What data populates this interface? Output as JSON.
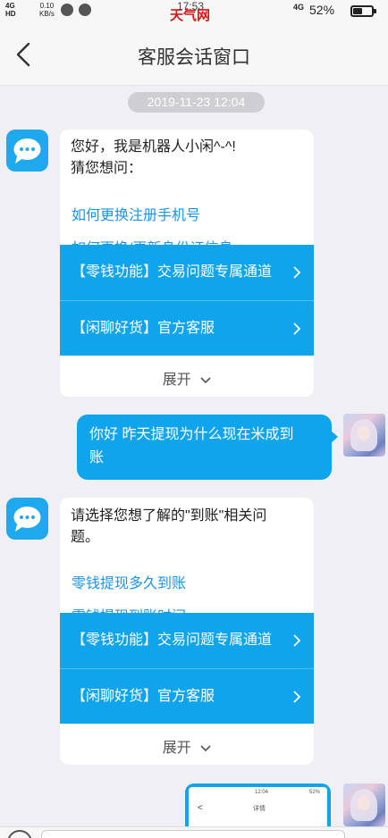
{
  "status_bar": {
    "network_top": "4G",
    "network_bottom": "HD",
    "speed_value": "0.10",
    "speed_unit": "KB/s",
    "clock": "17:53",
    "watermark": "天气网",
    "net_right": "4G",
    "battery_pct": "52%",
    "battery_level": 0.52
  },
  "nav": {
    "title": "客服会话窗口"
  },
  "timestamp": "2019-11-23 12:04",
  "bot_message_1": {
    "line1": "您好，我是机器人小闲^-^!",
    "line2": "猜您想问：",
    "link1": "如何更换注册手机号",
    "link2_cut": "如何更换/更新身份证信息"
  },
  "options": {
    "opt1": "【零钱功能】交易问题专属通道",
    "opt2": "【闲聊好货】官方客服",
    "expand": "展开"
  },
  "user_message": {
    "line1": "你好  昨天提现为什么现在米成到",
    "line2": "账"
  },
  "bot_message_2": {
    "line1": "请选择您想了解的\"到账\"相关问",
    "line2": "题。",
    "link1": "零钱提现多久到账",
    "link2_cut": "零钱提现到账时间"
  },
  "shot": {
    "time": "12:04",
    "title": "详情",
    "battery": "52%",
    "back": "<"
  },
  "colors": {
    "accent": "#0fa4ec",
    "link": "#1d93e8",
    "background": "#efeff4"
  }
}
